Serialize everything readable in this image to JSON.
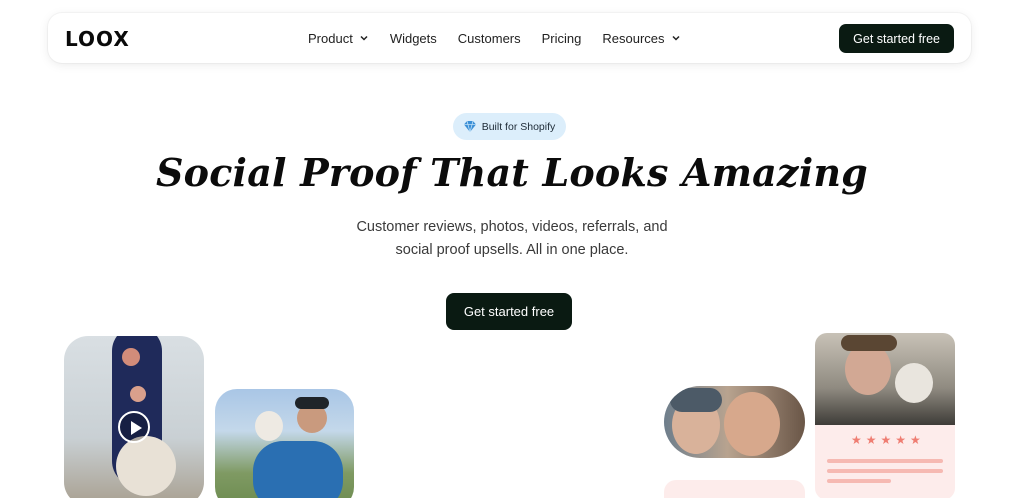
{
  "brand": {
    "logo": "LOOX"
  },
  "nav": {
    "items": [
      {
        "label": "Product",
        "has_dropdown": true
      },
      {
        "label": "Widgets",
        "has_dropdown": false
      },
      {
        "label": "Customers",
        "has_dropdown": false
      },
      {
        "label": "Pricing",
        "has_dropdown": false
      },
      {
        "label": "Resources",
        "has_dropdown": true
      }
    ],
    "cta_label": "Get started free"
  },
  "hero": {
    "badge": {
      "icon": "diamond-icon",
      "label": "Built for Shopify"
    },
    "headline": "Social Proof That Looks Amazing",
    "subtitle_line1": "Customer reviews, photos, videos, referrals, and",
    "subtitle_line2": "social proof upsells. All in one place.",
    "cta_label": "Get started free"
  },
  "gallery": {
    "cards": [
      {
        "name": "customer-video-card",
        "icon": "play-icon"
      },
      {
        "name": "customer-photo-dog-card"
      },
      {
        "name": "customer-photo-selfie-card"
      },
      {
        "name": "customer-review-card",
        "rating": 5
      }
    ]
  },
  "colors": {
    "cta_bg": "#0a1a12",
    "badge_bg": "#dceefb",
    "review_bg": "#fdeceb",
    "star": "#ef7d72"
  }
}
